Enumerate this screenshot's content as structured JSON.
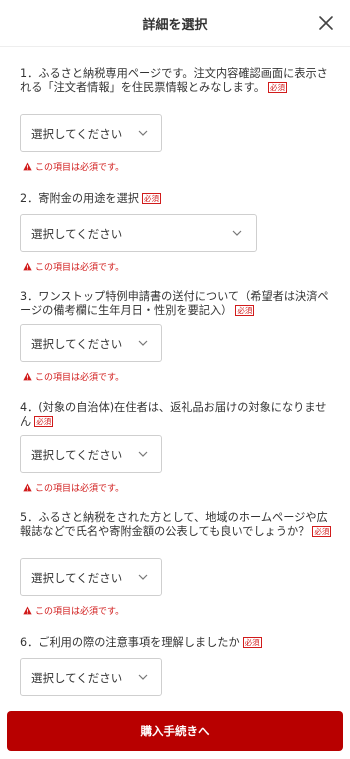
{
  "header": {
    "title": "詳細を選択"
  },
  "required_label": "必須",
  "select_placeholder": "選択してください",
  "error_message": "この項目は必須です。",
  "questions": [
    {
      "text": "1．ふるさと納税専用ページです。注文内容確認画面に表示される「注文者情報」を住民票情報とみなします。"
    },
    {
      "text": "2．寄附金の用途を選択"
    },
    {
      "text": "3．ワンストップ特例申請書の送付について（希望者は決済ページの備考欄に生年月日・性別を要記入）"
    },
    {
      "text": "4．(対象の自治体)在住者は、返礼品お届けの対象になりません"
    },
    {
      "text": "5．ふるさと納税をされた方として、地域のホームページや広報誌などで氏名や寄附金額の公表しても良いでしょうか？"
    },
    {
      "text": "6．ご利用の際の注意事項を理解しましたか"
    }
  ],
  "footer": {
    "button_label": "購入手続きへ"
  },
  "colors": {
    "accent": "#b80000",
    "error": "#d11b1b"
  },
  "icons": {
    "close": "close-icon",
    "chevron": "chevron-down-icon",
    "warning": "warning-icon"
  }
}
